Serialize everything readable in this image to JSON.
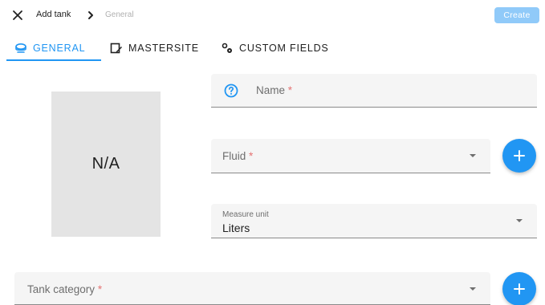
{
  "header": {
    "title": "Add tank",
    "breadcrumb_current": "General",
    "create_label": "Create",
    "close_icon": "close-icon",
    "separator_icon": "chevron-right-icon"
  },
  "tabs": [
    {
      "label": "GENERAL",
      "icon": "tank-icon",
      "active": true
    },
    {
      "label": "MASTERSITE",
      "icon": "site-edit-icon",
      "active": false
    },
    {
      "label": "CUSTOM FIELDS",
      "icon": "gears-icon",
      "active": false
    }
  ],
  "image_placeholder": "N/A",
  "form": {
    "name": {
      "label": "Name",
      "required_mark": "*"
    },
    "fluid": {
      "label": "Fluid",
      "required_mark": "*"
    },
    "measure_unit": {
      "label": "Measure unit",
      "value": "Liters"
    },
    "tank_category": {
      "label": "Tank category",
      "required_mark": "*"
    }
  },
  "colors": {
    "accent": "#2196f3",
    "create_disabled": "#90caf9",
    "required": "#e57373",
    "field_bg": "#f5f5f5",
    "placeholder_bg": "#e4e4e4"
  }
}
